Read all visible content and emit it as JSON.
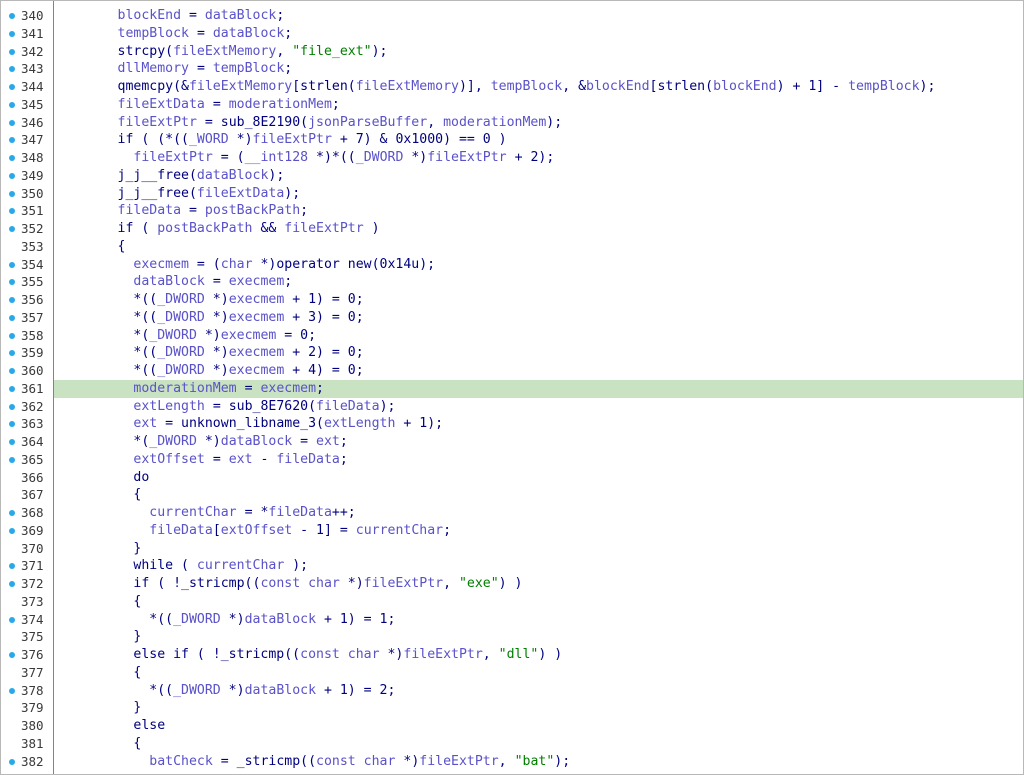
{
  "editor": {
    "highlight_color": "#c8e2c2",
    "gutter_dot_color": "#2aa9e8",
    "gutter_border_color": "#4a90d9",
    "highlighted_line": "361",
    "lines": [
      {
        "num": "340",
        "dot": true,
        "tokens": [
          [
            "k",
            "        "
          ],
          [
            "v",
            "blockEnd"
          ],
          [
            "k",
            " = "
          ],
          [
            "v",
            "dataBlock"
          ],
          [
            "k",
            ";"
          ]
        ]
      },
      {
        "num": "341",
        "dot": true,
        "tokens": [
          [
            "k",
            "        "
          ],
          [
            "v",
            "tempBlock"
          ],
          [
            "k",
            " = "
          ],
          [
            "v",
            "dataBlock"
          ],
          [
            "k",
            ";"
          ]
        ]
      },
      {
        "num": "342",
        "dot": true,
        "tokens": [
          [
            "k",
            "        strcpy("
          ],
          [
            "v",
            "fileExtMemory"
          ],
          [
            "k",
            ", "
          ],
          [
            "s",
            "\"file_ext\""
          ],
          [
            "k",
            ");"
          ]
        ]
      },
      {
        "num": "343",
        "dot": true,
        "tokens": [
          [
            "k",
            "        "
          ],
          [
            "v",
            "dllMemory"
          ],
          [
            "k",
            " = "
          ],
          [
            "v",
            "tempBlock"
          ],
          [
            "k",
            ";"
          ]
        ]
      },
      {
        "num": "344",
        "dot": true,
        "tokens": [
          [
            "k",
            "        qmemcpy(&"
          ],
          [
            "v",
            "fileExtMemory"
          ],
          [
            "k",
            "[strlen("
          ],
          [
            "v",
            "fileExtMemory"
          ],
          [
            "k",
            ")], "
          ],
          [
            "v",
            "tempBlock"
          ],
          [
            "k",
            ", &"
          ],
          [
            "v",
            "blockEnd"
          ],
          [
            "k",
            "[strlen("
          ],
          [
            "v",
            "blockEnd"
          ],
          [
            "k",
            ") + 1] - "
          ],
          [
            "v",
            "tempBlock"
          ],
          [
            "k",
            ");"
          ]
        ]
      },
      {
        "num": "345",
        "dot": true,
        "tokens": [
          [
            "k",
            "        "
          ],
          [
            "v",
            "fileExtData"
          ],
          [
            "k",
            " = "
          ],
          [
            "v",
            "moderationMem"
          ],
          [
            "k",
            ";"
          ]
        ]
      },
      {
        "num": "346",
        "dot": true,
        "tokens": [
          [
            "k",
            "        "
          ],
          [
            "v",
            "fileExtPtr"
          ],
          [
            "k",
            " = sub_8E2190("
          ],
          [
            "v",
            "jsonParseBuffer"
          ],
          [
            "k",
            ", "
          ],
          [
            "v",
            "moderationMem"
          ],
          [
            "k",
            ");"
          ]
        ]
      },
      {
        "num": "347",
        "dot": true,
        "tokens": [
          [
            "k",
            "        if ( (*(("
          ],
          [
            "v",
            "_WORD"
          ],
          [
            "k",
            " *)"
          ],
          [
            "v",
            "fileExtPtr"
          ],
          [
            "k",
            " + 7) & 0x1000) == 0 )"
          ]
        ]
      },
      {
        "num": "348",
        "dot": true,
        "tokens": [
          [
            "k",
            "          "
          ],
          [
            "v",
            "fileExtPtr"
          ],
          [
            "k",
            " = ("
          ],
          [
            "v",
            "__int128"
          ],
          [
            "k",
            " *)*(("
          ],
          [
            "v",
            "_DWORD"
          ],
          [
            "k",
            " *)"
          ],
          [
            "v",
            "fileExtPtr"
          ],
          [
            "k",
            " + 2);"
          ]
        ]
      },
      {
        "num": "349",
        "dot": true,
        "tokens": [
          [
            "k",
            "        j_j__free("
          ],
          [
            "v",
            "dataBlock"
          ],
          [
            "k",
            ");"
          ]
        ]
      },
      {
        "num": "350",
        "dot": true,
        "tokens": [
          [
            "k",
            "        j_j__free("
          ],
          [
            "v",
            "fileExtData"
          ],
          [
            "k",
            ");"
          ]
        ]
      },
      {
        "num": "351",
        "dot": true,
        "tokens": [
          [
            "k",
            "        "
          ],
          [
            "v",
            "fileData"
          ],
          [
            "k",
            " = "
          ],
          [
            "v",
            "postBackPath"
          ],
          [
            "k",
            ";"
          ]
        ]
      },
      {
        "num": "352",
        "dot": true,
        "tokens": [
          [
            "k",
            "        if ( "
          ],
          [
            "v",
            "postBackPath"
          ],
          [
            "k",
            " && "
          ],
          [
            "v",
            "fileExtPtr"
          ],
          [
            "k",
            " )"
          ]
        ]
      },
      {
        "num": "353",
        "dot": false,
        "tokens": [
          [
            "k",
            "        {"
          ]
        ]
      },
      {
        "num": "354",
        "dot": true,
        "tokens": [
          [
            "k",
            "          "
          ],
          [
            "v",
            "execmem"
          ],
          [
            "k",
            " = ("
          ],
          [
            "v",
            "char"
          ],
          [
            "k",
            " *)operator new(0x14u);"
          ]
        ]
      },
      {
        "num": "355",
        "dot": true,
        "tokens": [
          [
            "k",
            "          "
          ],
          [
            "v",
            "dataBlock"
          ],
          [
            "k",
            " = "
          ],
          [
            "v",
            "execmem"
          ],
          [
            "k",
            ";"
          ]
        ]
      },
      {
        "num": "356",
        "dot": true,
        "tokens": [
          [
            "k",
            "          *(("
          ],
          [
            "v",
            "_DWORD"
          ],
          [
            "k",
            " *)"
          ],
          [
            "v",
            "execmem"
          ],
          [
            "k",
            " + 1) = 0;"
          ]
        ]
      },
      {
        "num": "357",
        "dot": true,
        "tokens": [
          [
            "k",
            "          *(("
          ],
          [
            "v",
            "_DWORD"
          ],
          [
            "k",
            " *)"
          ],
          [
            "v",
            "execmem"
          ],
          [
            "k",
            " + 3) = 0;"
          ]
        ]
      },
      {
        "num": "358",
        "dot": true,
        "tokens": [
          [
            "k",
            "          *("
          ],
          [
            "v",
            "_DWORD"
          ],
          [
            "k",
            " *)"
          ],
          [
            "v",
            "execmem"
          ],
          [
            "k",
            " = 0;"
          ]
        ]
      },
      {
        "num": "359",
        "dot": true,
        "tokens": [
          [
            "k",
            "          *(("
          ],
          [
            "v",
            "_DWORD"
          ],
          [
            "k",
            " *)"
          ],
          [
            "v",
            "execmem"
          ],
          [
            "k",
            " + 2) = 0;"
          ]
        ]
      },
      {
        "num": "360",
        "dot": true,
        "tokens": [
          [
            "k",
            "          *(("
          ],
          [
            "v",
            "_DWORD"
          ],
          [
            "k",
            " *)"
          ],
          [
            "v",
            "execmem"
          ],
          [
            "k",
            " + 4) = 0;"
          ]
        ]
      },
      {
        "num": "361",
        "dot": true,
        "tokens": [
          [
            "k",
            "          "
          ],
          [
            "v",
            "moderationMem"
          ],
          [
            "k",
            " = "
          ],
          [
            "v",
            "execmem"
          ],
          [
            "k",
            ";"
          ]
        ]
      },
      {
        "num": "362",
        "dot": true,
        "tokens": [
          [
            "k",
            "          "
          ],
          [
            "v",
            "extLength"
          ],
          [
            "k",
            " = sub_8E7620("
          ],
          [
            "v",
            "fileData"
          ],
          [
            "k",
            ");"
          ]
        ]
      },
      {
        "num": "363",
        "dot": true,
        "tokens": [
          [
            "k",
            "          "
          ],
          [
            "v",
            "ext"
          ],
          [
            "k",
            " = unknown_libname_3("
          ],
          [
            "v",
            "extLength"
          ],
          [
            "k",
            " + 1);"
          ]
        ]
      },
      {
        "num": "364",
        "dot": true,
        "tokens": [
          [
            "k",
            "          *("
          ],
          [
            "v",
            "_DWORD"
          ],
          [
            "k",
            " *)"
          ],
          [
            "v",
            "dataBlock"
          ],
          [
            "k",
            " = "
          ],
          [
            "v",
            "ext"
          ],
          [
            "k",
            ";"
          ]
        ]
      },
      {
        "num": "365",
        "dot": true,
        "tokens": [
          [
            "k",
            "          "
          ],
          [
            "v",
            "extOffset"
          ],
          [
            "k",
            " = "
          ],
          [
            "v",
            "ext"
          ],
          [
            "k",
            " - "
          ],
          [
            "v",
            "fileData"
          ],
          [
            "k",
            ";"
          ]
        ]
      },
      {
        "num": "366",
        "dot": false,
        "tokens": [
          [
            "k",
            "          do"
          ]
        ]
      },
      {
        "num": "367",
        "dot": false,
        "tokens": [
          [
            "k",
            "          {"
          ]
        ]
      },
      {
        "num": "368",
        "dot": true,
        "tokens": [
          [
            "k",
            "            "
          ],
          [
            "v",
            "currentChar"
          ],
          [
            "k",
            " = *"
          ],
          [
            "v",
            "fileData"
          ],
          [
            "k",
            "++;"
          ]
        ]
      },
      {
        "num": "369",
        "dot": true,
        "tokens": [
          [
            "k",
            "            "
          ],
          [
            "v",
            "fileData"
          ],
          [
            "k",
            "["
          ],
          [
            "v",
            "extOffset"
          ],
          [
            "k",
            " - 1] = "
          ],
          [
            "v",
            "currentChar"
          ],
          [
            "k",
            ";"
          ]
        ]
      },
      {
        "num": "370",
        "dot": false,
        "tokens": [
          [
            "k",
            "          }"
          ]
        ]
      },
      {
        "num": "371",
        "dot": true,
        "tokens": [
          [
            "k",
            "          while ( "
          ],
          [
            "v",
            "currentChar"
          ],
          [
            "k",
            " );"
          ]
        ]
      },
      {
        "num": "372",
        "dot": true,
        "tokens": [
          [
            "k",
            "          if ( !_stricmp(("
          ],
          [
            "v",
            "const char"
          ],
          [
            "k",
            " *)"
          ],
          [
            "v",
            "fileExtPtr"
          ],
          [
            "k",
            ", "
          ],
          [
            "s",
            "\"exe\""
          ],
          [
            "k",
            ") )"
          ]
        ]
      },
      {
        "num": "373",
        "dot": false,
        "tokens": [
          [
            "k",
            "          {"
          ]
        ]
      },
      {
        "num": "374",
        "dot": true,
        "tokens": [
          [
            "k",
            "            *(("
          ],
          [
            "v",
            "_DWORD"
          ],
          [
            "k",
            " *)"
          ],
          [
            "v",
            "dataBlock"
          ],
          [
            "k",
            " + 1) = 1;"
          ]
        ]
      },
      {
        "num": "375",
        "dot": false,
        "tokens": [
          [
            "k",
            "          }"
          ]
        ]
      },
      {
        "num": "376",
        "dot": true,
        "tokens": [
          [
            "k",
            "          else if ( !_stricmp(("
          ],
          [
            "v",
            "const char"
          ],
          [
            "k",
            " *)"
          ],
          [
            "v",
            "fileExtPtr"
          ],
          [
            "k",
            ", "
          ],
          [
            "s",
            "\"dll\""
          ],
          [
            "k",
            ") )"
          ]
        ]
      },
      {
        "num": "377",
        "dot": false,
        "tokens": [
          [
            "k",
            "          {"
          ]
        ]
      },
      {
        "num": "378",
        "dot": true,
        "tokens": [
          [
            "k",
            "            *(("
          ],
          [
            "v",
            "_DWORD"
          ],
          [
            "k",
            " *)"
          ],
          [
            "v",
            "dataBlock"
          ],
          [
            "k",
            " + 1) = 2;"
          ]
        ]
      },
      {
        "num": "379",
        "dot": false,
        "tokens": [
          [
            "k",
            "          }"
          ]
        ]
      },
      {
        "num": "380",
        "dot": false,
        "tokens": [
          [
            "k",
            "          else"
          ]
        ]
      },
      {
        "num": "381",
        "dot": false,
        "tokens": [
          [
            "k",
            "          {"
          ]
        ]
      },
      {
        "num": "382",
        "dot": true,
        "tokens": [
          [
            "k",
            "            "
          ],
          [
            "v",
            "batCheck"
          ],
          [
            "k",
            " = _stricmp(("
          ],
          [
            "v",
            "const char"
          ],
          [
            "k",
            " *)"
          ],
          [
            "v",
            "fileExtPtr"
          ],
          [
            "k",
            ", "
          ],
          [
            "s",
            "\"bat\""
          ],
          [
            "k",
            ");"
          ]
        ]
      }
    ]
  }
}
